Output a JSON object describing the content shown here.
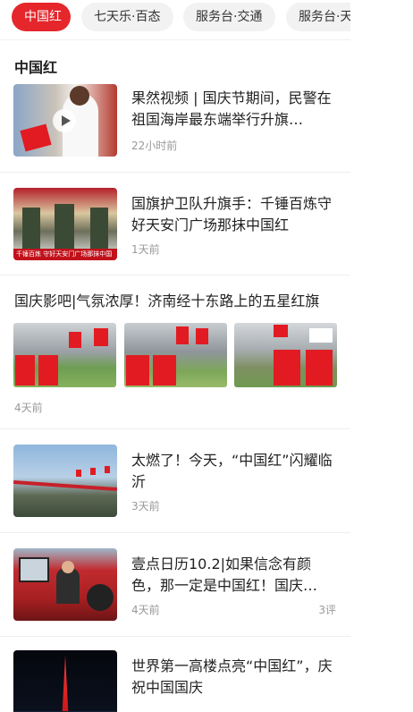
{
  "tabs": [
    {
      "label": "中国红",
      "active": true
    },
    {
      "label": "七天乐·百态",
      "active": false
    },
    {
      "label": "服务台·交通",
      "active": false
    },
    {
      "label": "服务台·天",
      "active": false
    }
  ],
  "section_title": "中国红",
  "articles": [
    {
      "title": "果然视频 | 国庆节期间，民警在祖国海岸最东端举行升旗…",
      "time": "22小时前",
      "video": true,
      "thumb_icon": "play-icon"
    },
    {
      "title": "国旗护卫队升旗手：千锤百炼守好天安门广场那抹中国红",
      "time": "1天前",
      "thumb_caption": "千锤百炼 守好天安门广场那抹中国"
    },
    {
      "title": "国庆影吧|气氛浓厚！济南经十东路上的五星红旗",
      "time": "4天前",
      "gallery": 3
    },
    {
      "title": "太燃了！今天，“中国红”闪耀临沂",
      "time": "3天前"
    },
    {
      "title": "壹点日历10.2|如果信念有颜色，那一定是中国红！国庆…",
      "time": "4天前",
      "comments": "3评"
    },
    {
      "title": "世界第一高楼点亮“中国红”，庆祝中国国庆",
      "time": ""
    }
  ],
  "colors": {
    "accent": "#e5262b",
    "meta": "#999999",
    "tab_bg": "#f2f2f2"
  }
}
